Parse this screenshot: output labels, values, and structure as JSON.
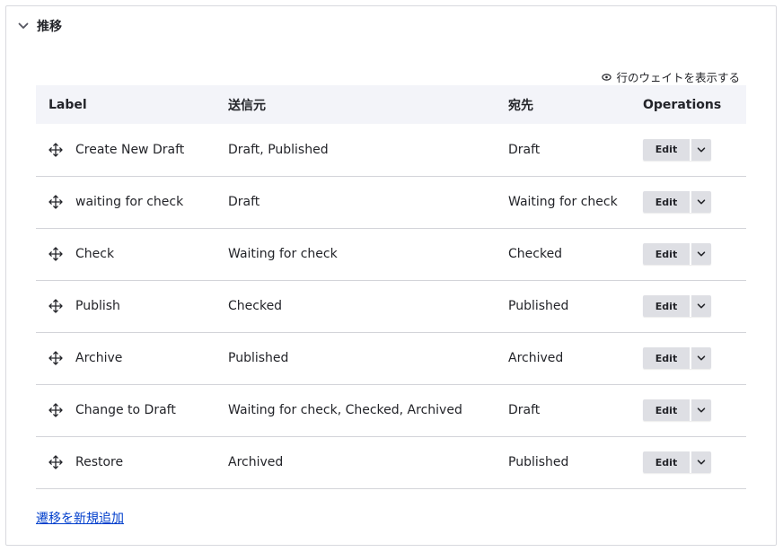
{
  "section": {
    "title": "推移"
  },
  "weights_toggle": {
    "label": "行のウェイトを表示する"
  },
  "table": {
    "headers": {
      "label": "Label",
      "from": "送信元",
      "to": "宛先",
      "operations": "Operations"
    },
    "rows": [
      {
        "label": "Create New Draft",
        "from": "Draft, Published",
        "to": "Draft",
        "edit": "Edit"
      },
      {
        "label": "waiting for check",
        "from": "Draft",
        "to": "Waiting for check",
        "edit": "Edit"
      },
      {
        "label": "Check",
        "from": "Waiting for check",
        "to": "Checked",
        "edit": "Edit"
      },
      {
        "label": "Publish",
        "from": "Checked",
        "to": "Published",
        "edit": "Edit"
      },
      {
        "label": "Archive",
        "from": "Published",
        "to": "Archived",
        "edit": "Edit"
      },
      {
        "label": "Change to Draft",
        "from": "Waiting for check, Checked, Archived",
        "to": "Draft",
        "edit": "Edit"
      },
      {
        "label": "Restore",
        "from": "Archived",
        "to": "Published",
        "edit": "Edit"
      }
    ]
  },
  "add_link": {
    "label": "遷移を新規追加"
  },
  "colors": {
    "header_bg": "#f3f4f9",
    "button_bg": "#dedfe4",
    "link": "#003ecc",
    "border": "#d3d4d9"
  }
}
